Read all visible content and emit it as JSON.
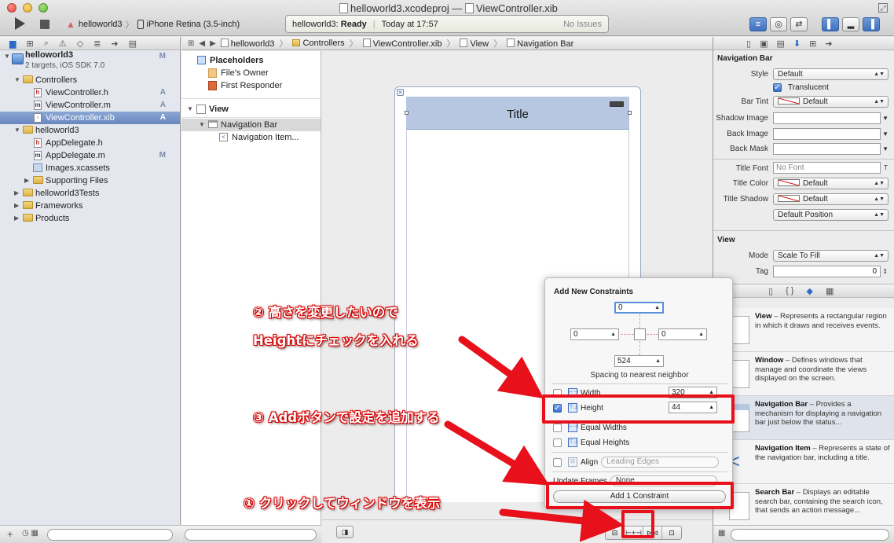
{
  "window": {
    "title_project": "helloworld3.xcodeproj",
    "title_separator": "—",
    "title_file": "ViewController.xib"
  },
  "toolbar": {
    "scheme": "helloworld3",
    "scheme_sep": "〉",
    "destination": "iPhone Retina (3.5-inch)",
    "status_app": "helloworld3:",
    "status_state": "Ready",
    "status_sep": "|",
    "status_time": "Today at 17:57",
    "status_issues": "No Issues"
  },
  "navigator": {
    "project_name": "helloworld3",
    "project_sub": "2 targets, iOS SDK 7.0",
    "project_badge": "M",
    "items": [
      {
        "label": "Controllers",
        "badge": ""
      },
      {
        "label": "ViewController.h",
        "badge": "A"
      },
      {
        "label": "ViewController.m",
        "badge": "A"
      },
      {
        "label": "ViewController.xib",
        "badge": "A"
      },
      {
        "label": "helloworld3",
        "badge": ""
      },
      {
        "label": "AppDelegate.h",
        "badge": ""
      },
      {
        "label": "AppDelegate.m",
        "badge": "M"
      },
      {
        "label": "Images.xcassets",
        "badge": ""
      },
      {
        "label": "Supporting Files",
        "badge": ""
      },
      {
        "label": "helloworld3Tests",
        "badge": ""
      },
      {
        "label": "Frameworks",
        "badge": ""
      },
      {
        "label": "Products",
        "badge": ""
      }
    ]
  },
  "jumpbar": {
    "items": [
      "helloworld3",
      "Controllers",
      "ViewController.xib",
      "View",
      "Navigation Bar"
    ]
  },
  "outline": {
    "placeholders_header": "Placeholders",
    "files_owner": "File's Owner",
    "first_responder": "First Responder",
    "view_header": "View",
    "navigation_bar": "Navigation Bar",
    "navigation_item": "Navigation Item..."
  },
  "canvas": {
    "nav_title": "Title"
  },
  "constraints_popover": {
    "title": "Add New Constraints",
    "top": "0",
    "left": "0",
    "right": "0",
    "bottom": "524",
    "spacing_label": "Spacing to nearest neighbor",
    "width_label": "Width",
    "width_value": "320",
    "height_label": "Height",
    "height_value": "44",
    "equal_widths": "Equal Widths",
    "equal_heights": "Equal Heights",
    "align_label": "Align",
    "align_value": "Leading Edges",
    "update_frames_label": "Update Frames",
    "update_frames_value": "None",
    "add_button": "Add 1 Constraint"
  },
  "inspector": {
    "nav_section": "Navigation Bar",
    "style_label": "Style",
    "style_value": "Default",
    "translucent_label": "Translucent",
    "bar_tint_label": "Bar Tint",
    "bar_tint_value": "Default",
    "shadow_image_label": "Shadow Image",
    "back_image_label": "Back Image",
    "back_mask_label": "Back Mask",
    "title_font_label": "Title Font",
    "title_font_value": "No Font",
    "title_color_label": "Title Color",
    "title_color_value": "Default",
    "title_shadow_label": "Title Shadow",
    "title_shadow_value": "Default",
    "shadow_position_value": "Default Position",
    "view_section": "View",
    "mode_label": "Mode",
    "mode_value": "Scale To Fill",
    "tag_label": "Tag",
    "tag_value": "0"
  },
  "library": {
    "items": [
      {
        "name": "View",
        "desc": " – Represents a rectangular region in which it draws and receives events."
      },
      {
        "name": "Window",
        "desc": " – Defines windows that manage and coordinate the views displayed on the screen."
      },
      {
        "name": "Navigation Bar",
        "desc": " – Provides a mechanism for displaying a navigation bar just below the status..."
      },
      {
        "name": "Navigation Item",
        "desc": " – Represents a state of the navigation bar, including a title."
      },
      {
        "name": "Search Bar",
        "desc": " – Displays an editable search bar, containing the search icon, that sends an action message..."
      }
    ]
  },
  "annotations": {
    "step2_line1": "② 高さを変更したいので",
    "step2_line2": "Heightにチェックを入れる",
    "step3": "③ Addボタンで設定を追加する",
    "step1": "① クリックしてウィンドウを表示",
    "color": "#e8101a"
  }
}
